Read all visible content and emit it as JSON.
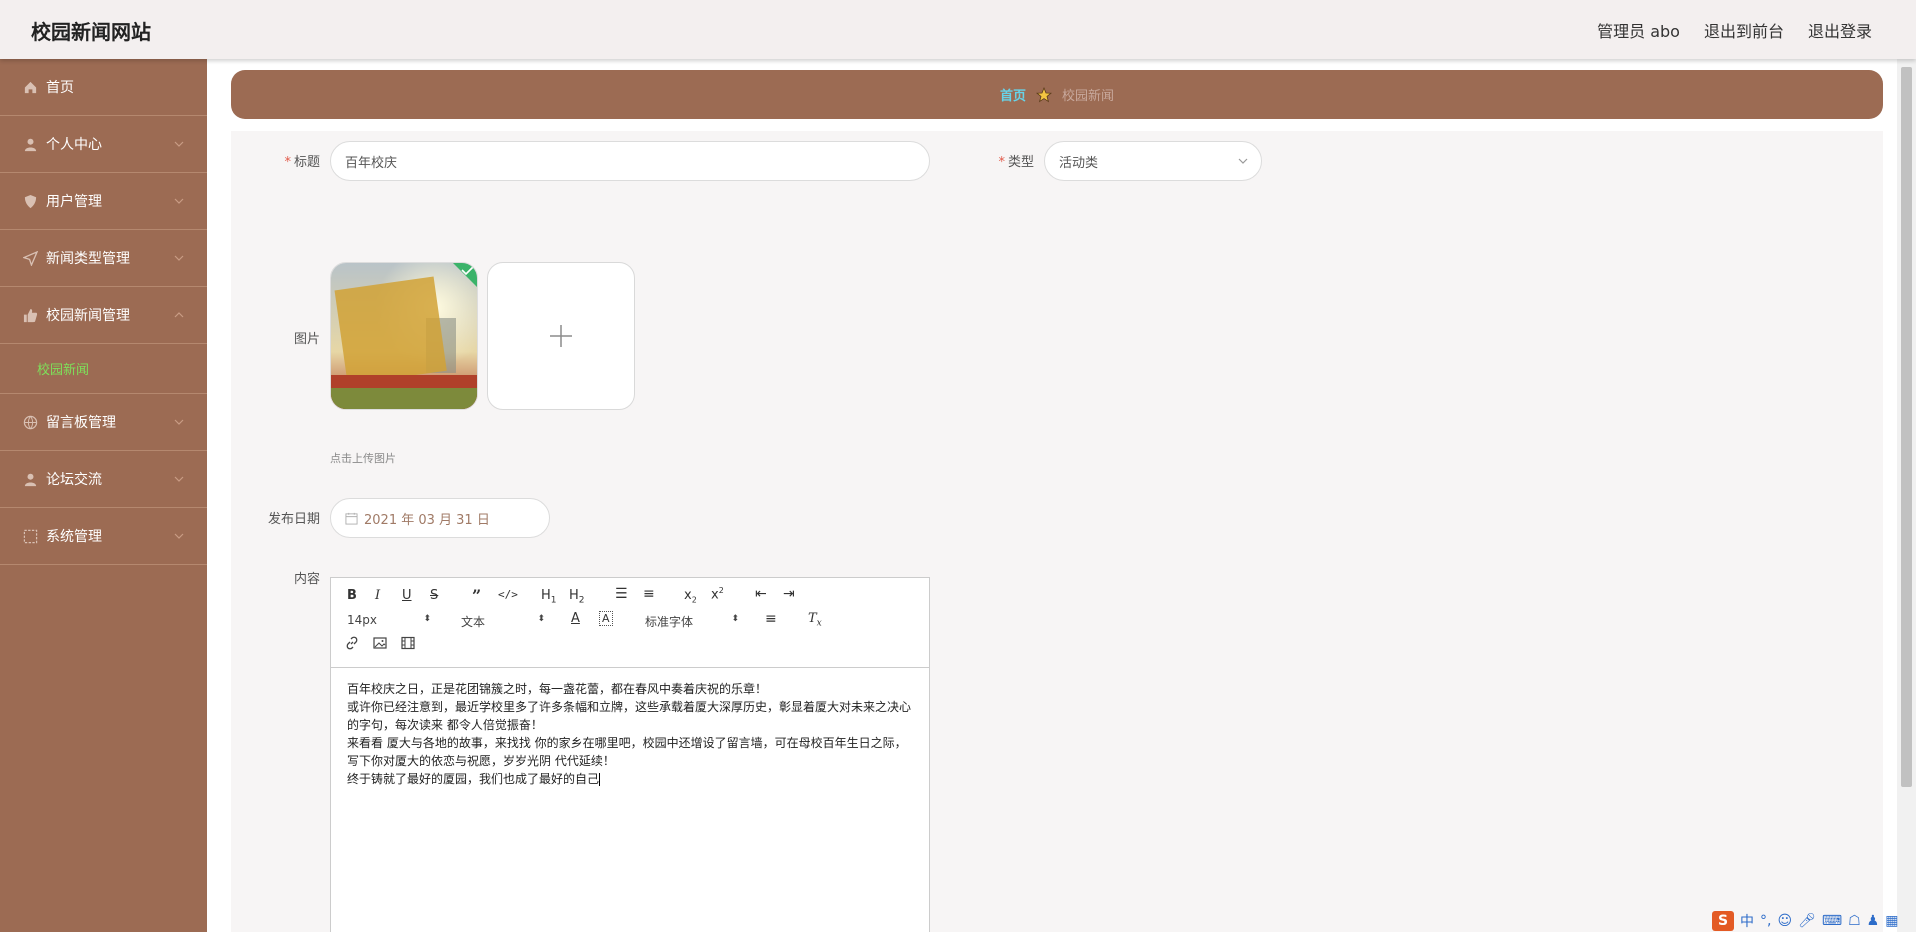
{
  "header": {
    "brand": "校园新闻网站",
    "nav": [
      "管理员 abo",
      "退出到前台",
      "退出登录"
    ]
  },
  "sidebar": {
    "items": [
      {
        "label": "首页",
        "icon": "home-icon",
        "expandable": false
      },
      {
        "label": "个人中心",
        "icon": "user-icon",
        "expandable": true
      },
      {
        "label": "用户管理",
        "icon": "shield-icon",
        "expandable": true
      },
      {
        "label": "新闻类型管理",
        "icon": "send-icon",
        "expandable": true
      },
      {
        "label": "校园新闻管理",
        "icon": "thumb-icon",
        "expandable": true,
        "open": true
      },
      {
        "label": "留言板管理",
        "icon": "globe-icon",
        "expandable": true
      },
      {
        "label": "论坛交流",
        "icon": "user-icon",
        "expandable": true
      },
      {
        "label": "系统管理",
        "icon": "frame-icon",
        "expandable": true
      }
    ],
    "active_sub": "校园新闻"
  },
  "breadcrumb": {
    "home": "首页",
    "current": "校园新闻"
  },
  "form": {
    "title_label": "标题",
    "title_value": "百年校庆",
    "type_label": "类型",
    "type_value": "活动类",
    "image_label": "图片",
    "upload_hint": "点击上传图片",
    "date_label": "发布日期",
    "date_value": "2021 年 03 月 31 日",
    "content_label": "内容"
  },
  "editor": {
    "font_size": "14px",
    "header_select": "文本",
    "font_family": "标准字体",
    "content": [
      "百年校庆之日，正是花团锦簇之时，每一盏花蕾，都在春风中奏着庆祝的乐章！",
      "或许你已经注意到，最近学校里多了许多条幅和立牌，这些承载着厦大深厚历史，彰显着厦大对未来之决心的字句，每次读来 都令人倍觉振奋！",
      "来看看 厦大与各地的故事，来找找 你的家乡在哪里吧，校园中还增设了留言墙，可在母校百年生日之际，写下你对厦大的依恋与祝愿，岁岁光阴 代代延续！",
      "终于铸就了最好的厦园，我们也成了最好的自己"
    ]
  },
  "colors": {
    "sidebar_bg": "#9c6b53",
    "header_bg": "#f3efef",
    "breadcrumb_home": "#67d3e8",
    "active_sub": "#7ee05a",
    "required": "#e25a4a"
  },
  "ime": {
    "lang": "中"
  }
}
